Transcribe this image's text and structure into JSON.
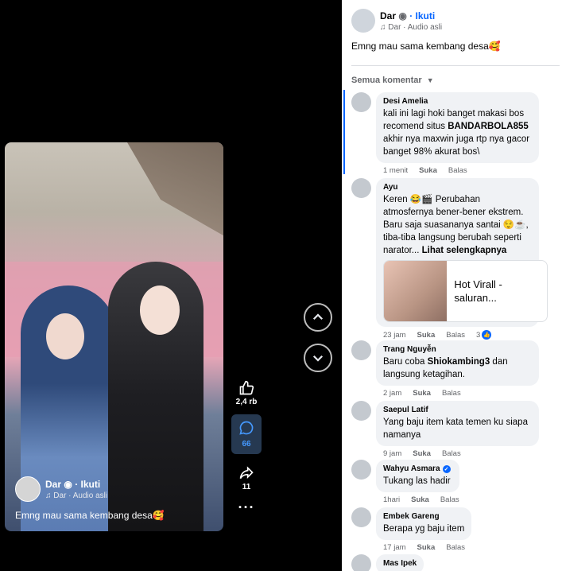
{
  "video": {
    "author": "Dar",
    "follow": "· Ikuti",
    "audio": "Dar · Audio asli",
    "caption": "Emng mau sama kembang desa🥰",
    "likes": "2,4 rb",
    "comments": "66",
    "shares": "11",
    "more": "···"
  },
  "icons": {
    "like": "thumbs-up-icon",
    "comment": "comment-bubble-icon",
    "share": "share-arrow-icon",
    "music": "music-note-icon",
    "prev": "chevron-up-icon",
    "next": "chevron-down-icon"
  },
  "panel": {
    "author": "Dar",
    "follow": "· Ikuti",
    "audio": "Dar · Audio asli",
    "caption": "Emng mau sama kembang desa🥰",
    "sort_label": "Semua komentar"
  },
  "comments": [
    {
      "name": "Desi Amelia",
      "text_pre": "kali ini lagi hoki banget makasi bos recomend situs ",
      "text_bold": "BANDARBOLA855",
      "text_post": " akhir nya maxwin juga rtp nya gacor banget 98% akurat bos\\",
      "time": "1 menit",
      "like": "Suka",
      "reply": "Balas"
    },
    {
      "name": "Ayu",
      "text": "Keren 😂🎬 Perubahan atmosfernya bener-bener ekstrem. Baru saja suasananya santai 😌☕, tiba-tiba langsung berubah seperti narator...",
      "see_more": "Lihat selengkapnya",
      "link_title": "Hot Virall - saluran...",
      "time": "23 jam",
      "like": "Suka",
      "reply": "Balas",
      "reactions": "3"
    },
    {
      "name": "Trang Nguyễn",
      "text_pre": "Baru coba ",
      "text_bold": "Shiokambing3",
      "text_post": " dan langsung ketagihan.",
      "time": "2 jam",
      "like": "Suka",
      "reply": "Balas"
    },
    {
      "name": "Saepul Latif",
      "text": "Yang baju item kata temen ku siapa namanya",
      "time": "9 jam",
      "like": "Suka",
      "reply": "Balas"
    },
    {
      "name": "Wahyu Asmara",
      "text": "Tukang las hadir",
      "time": "1hari",
      "like": "Suka",
      "reply": "Balas"
    },
    {
      "name": "Embek Gareng",
      "text": "Berapa yg baju item",
      "time": "17 jam",
      "like": "Suka",
      "reply": "Balas"
    },
    {
      "name": "Mas Ipek",
      "text": ""
    }
  ]
}
